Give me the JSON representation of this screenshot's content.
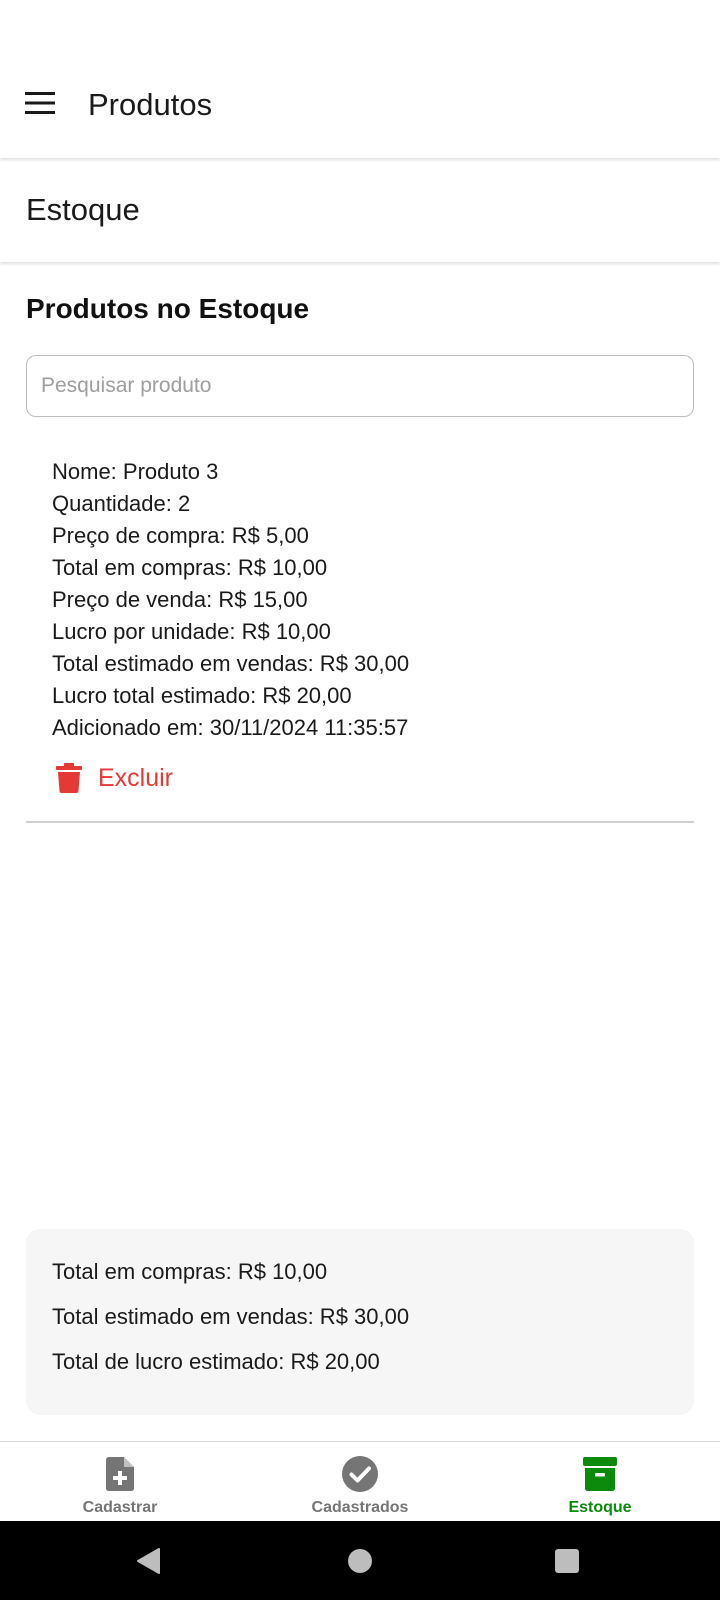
{
  "appbar": {
    "title": "Produtos",
    "menu_icon": "menu-icon"
  },
  "subheader": {
    "title": "Estoque"
  },
  "main": {
    "section_title": "Produtos no Estoque",
    "search": {
      "placeholder": "Pesquisar produto",
      "value": ""
    },
    "products": [
      {
        "lines": [
          "Nome: Produto 3",
          "Quantidade: 2",
          "Preço de compra: R$ 5,00",
          "Total em compras: R$ 10,00",
          "Preço de venda: R$ 15,00",
          "Lucro por unidade: R$ 10,00",
          "Total estimado em vendas: R$ 30,00",
          "Lucro total estimado: R$ 20,00",
          "Adicionado em: 30/11/2024 11:35:57"
        ],
        "delete_label": "Excluir",
        "delete_icon": "trash-icon"
      }
    ],
    "summary": {
      "total_compras": "Total em compras: R$ 10,00",
      "total_vendas": "Total estimado em vendas: R$ 30,00",
      "total_lucro": "Total de lucro estimado: R$ 20,00"
    }
  },
  "bottom_nav": {
    "items": [
      {
        "label": "Cadastrar",
        "icon": "add-file-icon",
        "active": false
      },
      {
        "label": "Cadastrados",
        "icon": "check-circle-icon",
        "active": false
      },
      {
        "label": "Estoque",
        "icon": "archive-box-icon",
        "active": true
      }
    ]
  },
  "colors": {
    "accent_active": "#0b8a0b",
    "danger": "#e53935",
    "inactive": "#757575"
  },
  "system_nav": {
    "icons": [
      "back-icon",
      "home-icon",
      "recents-icon"
    ]
  }
}
